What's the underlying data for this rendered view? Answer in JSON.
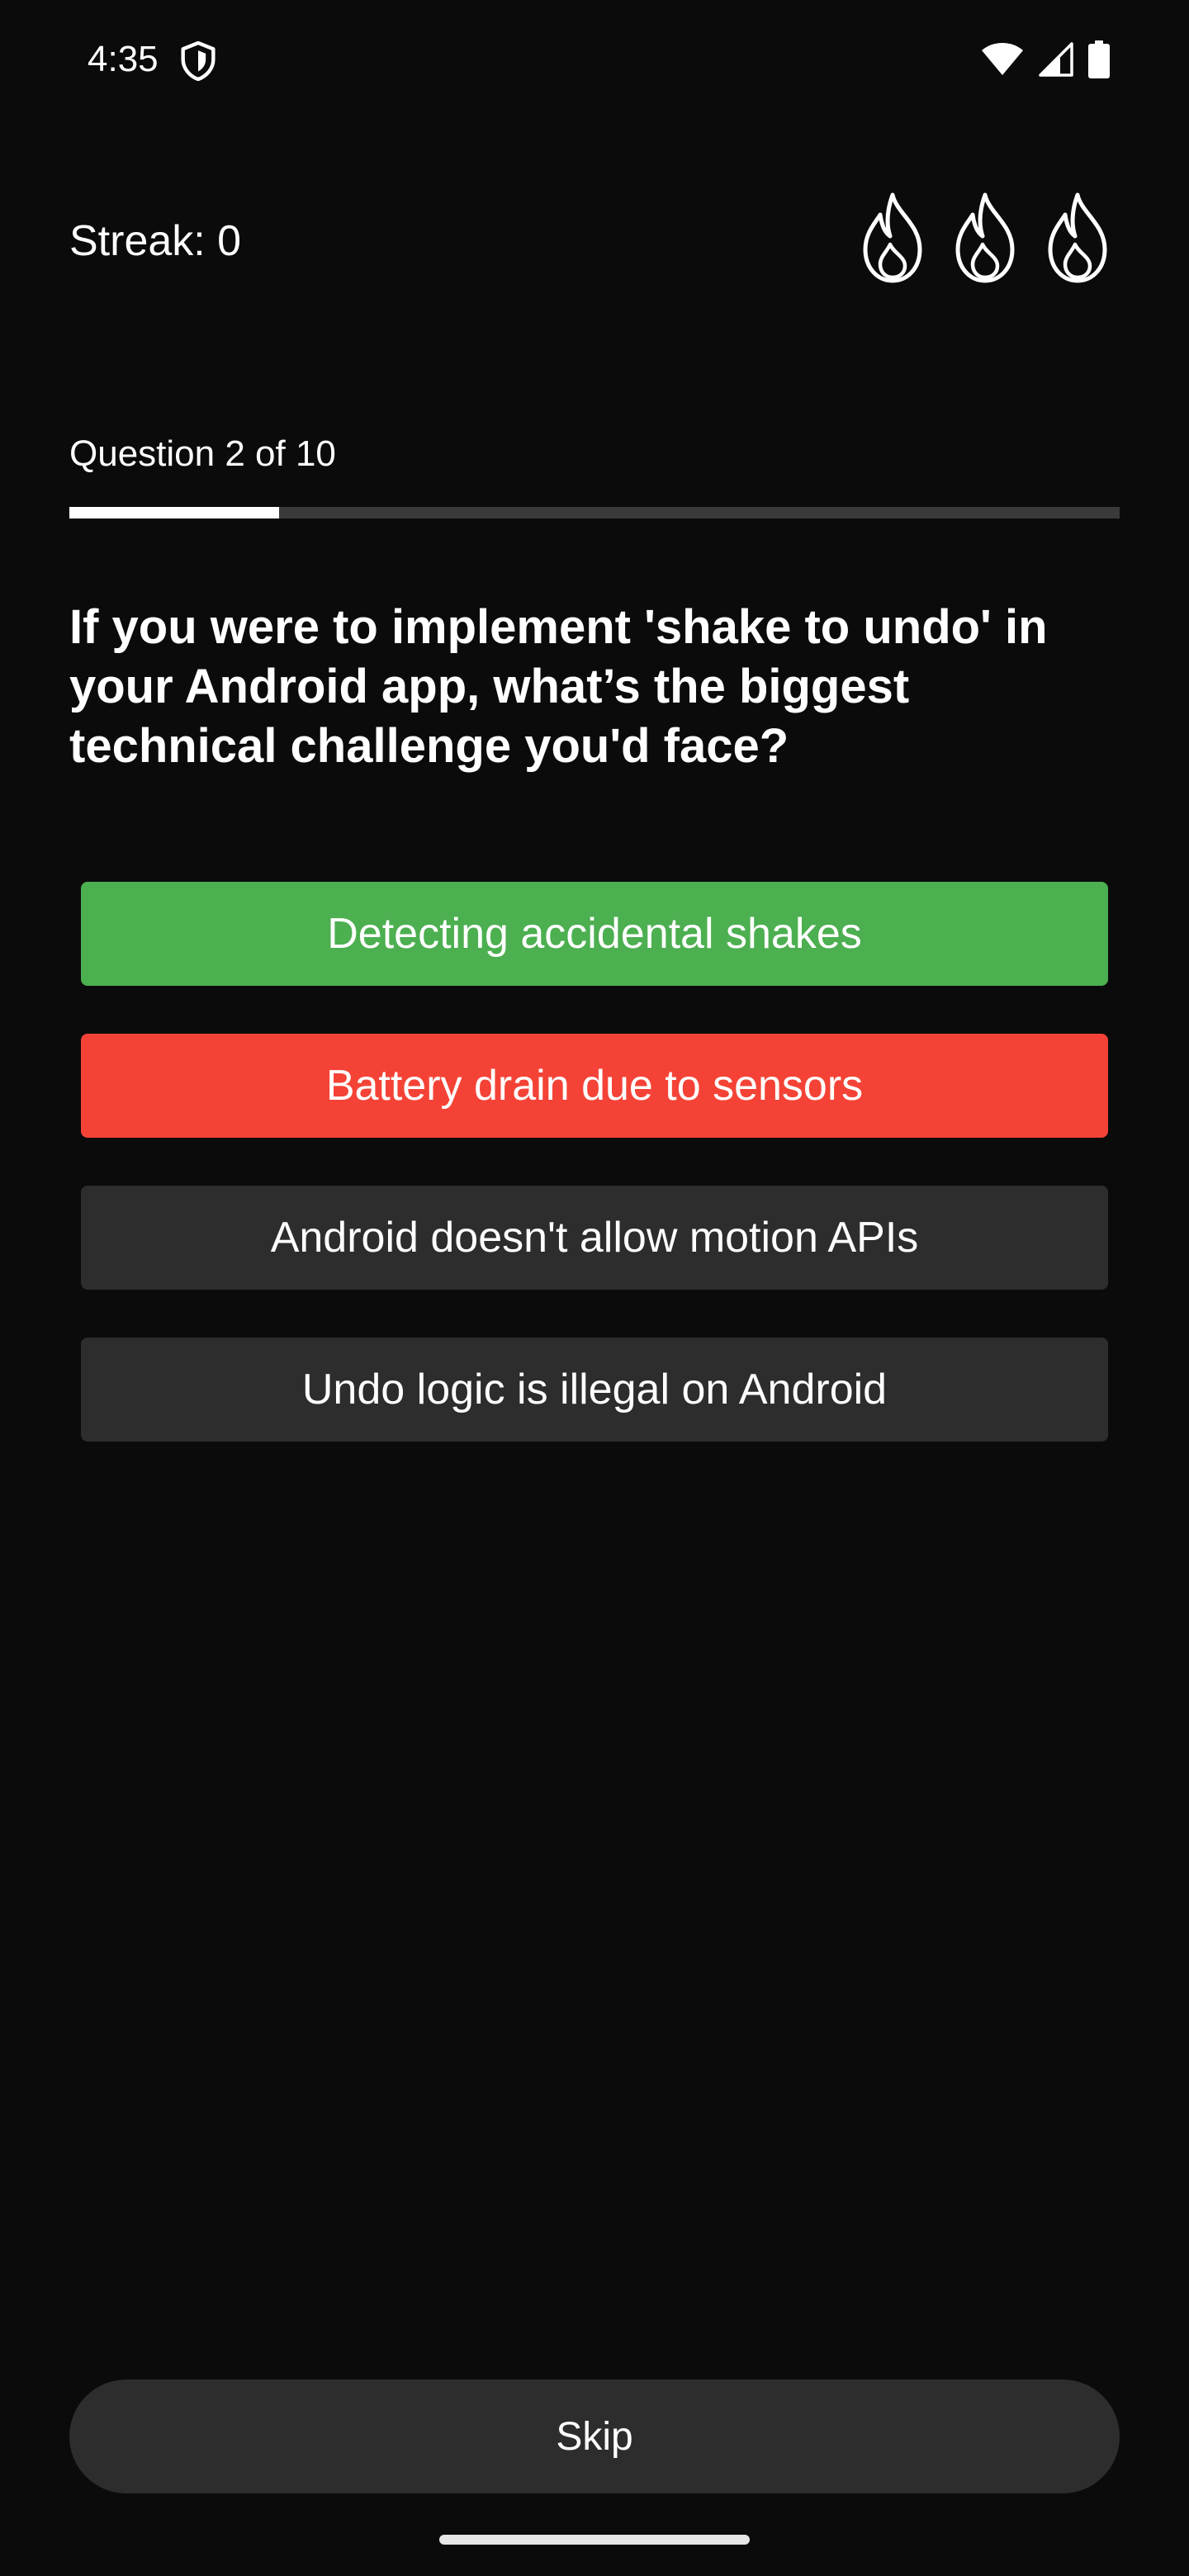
{
  "status_bar": {
    "time": "4:35",
    "icons": [
      "shield-icon",
      "wifi-icon",
      "cellular-signal-icon",
      "battery-icon"
    ]
  },
  "header": {
    "streak_label": "Streak: 0",
    "lives_icons": [
      "flame-icon",
      "flame-icon",
      "flame-icon"
    ]
  },
  "progress": {
    "label": "Question 2 of 10",
    "fraction": 0.2
  },
  "question": {
    "text": "If you were to implement 'shake to undo' in your Android app, what’s the biggest technical challenge you'd face?"
  },
  "answers": [
    {
      "label": "Detecting accidental shakes",
      "state": "correct",
      "color": "#4caf50"
    },
    {
      "label": "Battery drain due to sensors",
      "state": "incorrect",
      "color": "#f44336"
    },
    {
      "label": "Android doesn't allow motion APIs",
      "state": "neutral",
      "color": "#2d2d2d"
    },
    {
      "label": "Undo logic is illegal on Android",
      "state": "neutral",
      "color": "#2d2d2d"
    }
  ],
  "footer": {
    "skip_label": "Skip"
  },
  "colors": {
    "background": "#0b0b0b",
    "correct": "#4caf50",
    "incorrect": "#f44336",
    "neutral": "#2d2d2d",
    "progress_track": "#3a3a3a",
    "progress_fill": "#ffffff"
  }
}
